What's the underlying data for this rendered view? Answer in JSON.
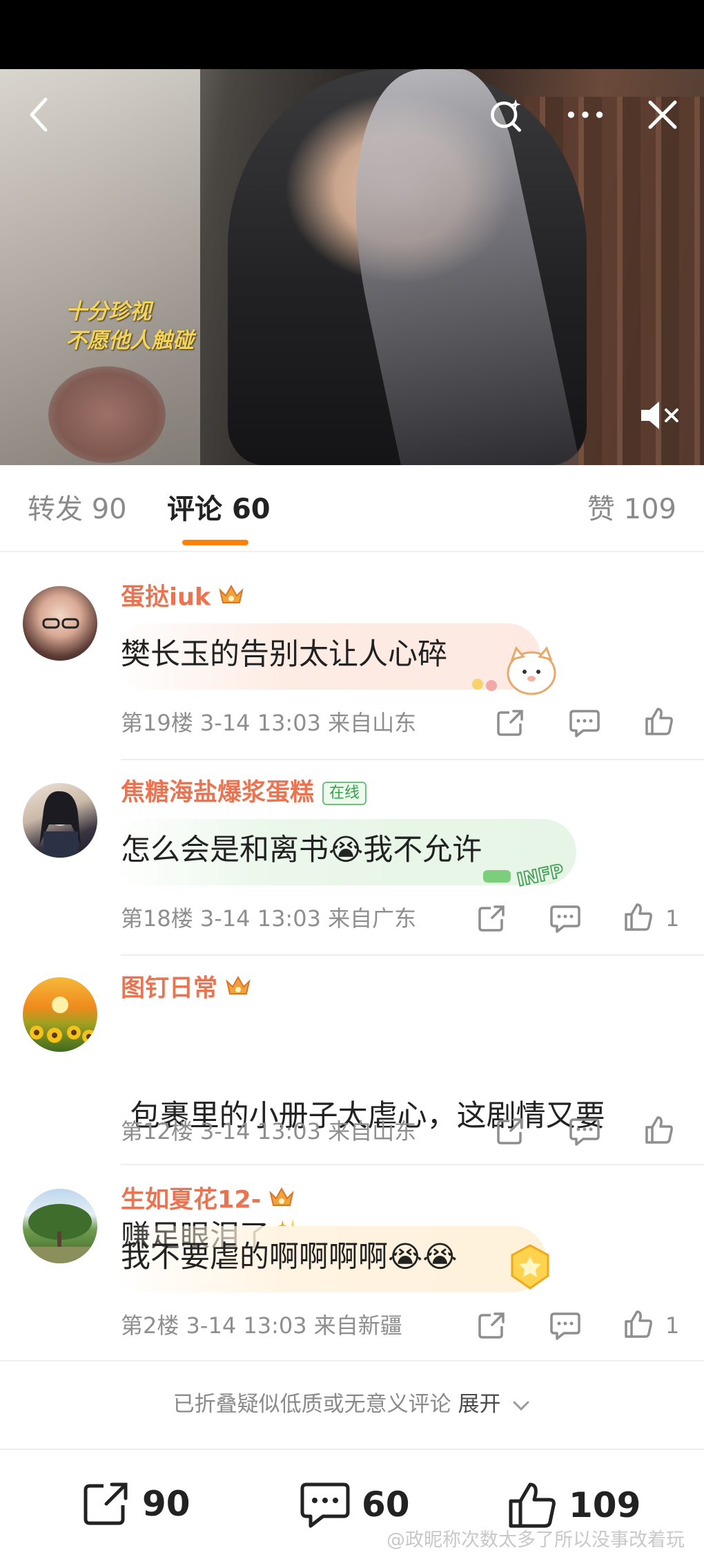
{
  "video": {
    "caption_line1": "十分珍视",
    "caption_line2": "不愿他人触碰"
  },
  "tabs": {
    "repost_label": "转发",
    "repost_count": "90",
    "comment_label": "评论",
    "comment_count": "60",
    "like_label": "赞",
    "like_count": "109"
  },
  "comments": [
    {
      "username": "蛋挞iuk",
      "text": "樊长玉的告别太让人心碎",
      "floor": "第19楼",
      "time": "3-14 13:03",
      "location": "来自山东",
      "likes": ""
    },
    {
      "username": "焦糖海盐爆浆蛋糕",
      "status": "在线",
      "text": "怎么会是和离书😭我不允许",
      "floor": "第18楼",
      "time": "3-14 13:03",
      "location": "来自广东",
      "likes": "1"
    },
    {
      "username": "图钉日常",
      "text_line1": " 包裹里的小册子太虐心，这剧情又要",
      "text_line2": "赚足眼泪了✨",
      "floor": "第12楼",
      "time": "3-14 13:03",
      "location": "来自山东",
      "likes": ""
    },
    {
      "username": "生如夏花12-",
      "text": "我不要虐的啊啊啊啊😭😭",
      "floor": "第2楼",
      "time": "3-14 13:03",
      "location": "来自新疆",
      "likes": "1"
    }
  ],
  "folded": {
    "text": "已折叠疑似低质或无意义评论",
    "expand": "展开"
  },
  "bottom": {
    "repost_count": "90",
    "comment_count": "60",
    "like_count": "109"
  },
  "watermark": "@政昵称次数太多了所以没事改着玩",
  "colors": {
    "accent": "#ff8200",
    "username": "#eb7350",
    "caption": "#f3d35a"
  }
}
